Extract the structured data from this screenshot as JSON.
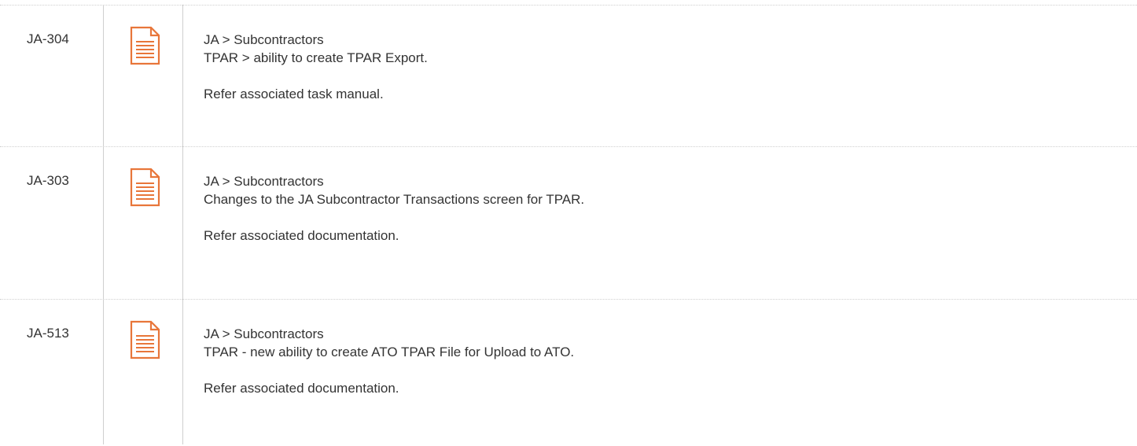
{
  "rows": [
    {
      "id": "JA-304",
      "icon": "document-icon",
      "line1": "JA > Subcontractors",
      "line2": "TPAR > ability to create TPAR Export.",
      "line3": "Refer associated task manual."
    },
    {
      "id": "JA-303",
      "icon": "document-icon",
      "line1": "JA > Subcontractors",
      "line2": "Changes to the JA Subcontractor Transactions screen for TPAR.",
      "line3": "Refer associated documentation."
    },
    {
      "id": "JA-513",
      "icon": "document-icon",
      "line1": "JA > Subcontractors",
      "line2": "TPAR - new ability to create ATO TPAR File for Upload to ATO.",
      "line3": "Refer associated documentation."
    }
  ],
  "colors": {
    "icon": "#e8763a",
    "grid": "#cfcfcf",
    "text": "#333333"
  }
}
